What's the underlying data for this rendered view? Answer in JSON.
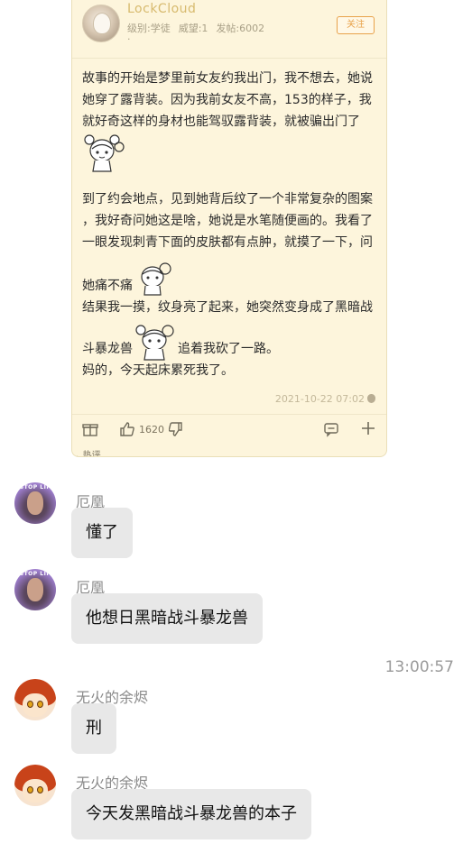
{
  "post": {
    "poster_name": "LockCloud",
    "poster_level": "级别:学徒",
    "poster_prestige": "威望:1",
    "poster_posts": "发帖:6002",
    "poster_dot": "·",
    "follow_label": "关注",
    "lines": [
      "故事的开始是梦里前女友约我出门，我不想去，她说",
      "她穿了露背装。因为我前女友不高，153的样子，我",
      "就好奇这样的身材也能驾驭露背装，就被骗出门了",
      "到了约会地点，见到她背后纹了一个非常复杂的图案",
      "，我好奇问她这是啥，她说是水笔随便画的。我看了",
      "一眼发现刺青下面的皮肤都有点肿，就摸了一下，问",
      "她痛不痛",
      "结果我一摸，纹身亮了起来，她突然变身成了黑暗战",
      "斗暴龙兽",
      "追着我砍了一路。",
      "妈的，今天起床累死我了。"
    ],
    "time": "2021-10-22 07:02",
    "like_count": "1620",
    "hot_label": "热评",
    "hot_chevron": "⌄"
  },
  "chat": {
    "messages": [
      {
        "sender": "厄凰",
        "text": "懂了"
      },
      {
        "sender": "厄凰",
        "text": "他想日黑暗战斗暴龙兽"
      },
      {
        "sender": "无火的余烬",
        "text": "刑"
      },
      {
        "sender": "无火的余烬",
        "text": "今天发黑暗战斗暴龙兽的本子"
      }
    ],
    "timestamp": "13:00:57",
    "avatar_caption": "STOP LIP"
  },
  "colors": {
    "card_bg": "#fdf5dc",
    "poster_name": "#d7ba6e",
    "follow_accent": "#e8a24a",
    "bubble_bg": "#e8e8e8"
  }
}
